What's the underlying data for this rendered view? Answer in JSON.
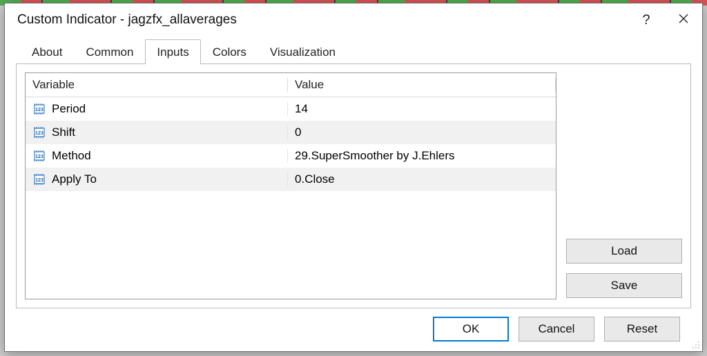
{
  "title": "Custom Indicator - jagzfx_allaverages",
  "tabs": {
    "about": "About",
    "common": "Common",
    "inputs": "Inputs",
    "colors": "Colors",
    "visualization": "Visualization"
  },
  "active_tab": "inputs",
  "grid": {
    "headers": {
      "variable": "Variable",
      "value": "Value"
    },
    "rows": [
      {
        "variable": "Period",
        "value": "14"
      },
      {
        "variable": "Shift",
        "value": "0"
      },
      {
        "variable": "Method",
        "value": "29.SuperSmoother by J.Ehlers"
      },
      {
        "variable": "Apply To",
        "value": "0.Close"
      }
    ]
  },
  "side_buttons": {
    "load": "Load",
    "save": "Save"
  },
  "footer": {
    "ok": "OK",
    "cancel": "Cancel",
    "reset": "Reset"
  }
}
